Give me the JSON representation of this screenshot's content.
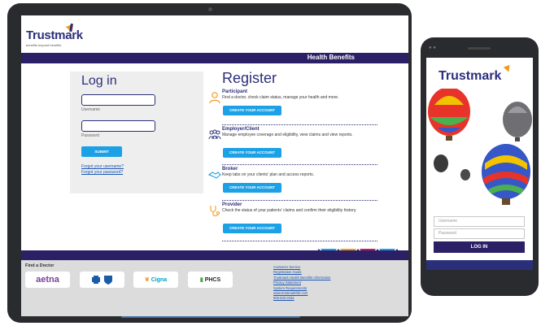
{
  "tablet": {
    "brand": {
      "name": "Trustmark",
      "tagline": "benefits beyond benefits"
    },
    "nav": {
      "title": "Health Benefits"
    },
    "login": {
      "title": "Log in",
      "username_label": "Username",
      "password_label": "Password",
      "submit": "SUBMIT",
      "forgot_username": "Forgot your username?",
      "forgot_password": "Forgot your password?"
    },
    "register": {
      "title": "Register",
      "items": [
        {
          "name": "Participant",
          "desc": "Find a doctor, check claim status, manage your health and more.",
          "button": "CREATE YOUR ACCOUNT",
          "icon": "person-icon"
        },
        {
          "name": "Employer/Client",
          "desc": "Manage employee coverage and eligibility, view claims and view reports.",
          "button": "CREATE YOUR ACCOUNT",
          "icon": "group-icon"
        },
        {
          "name": "Broker",
          "desc": "Keep tabs on your clients' plan and access reports.",
          "button": "CREATE YOUR ACCOUNT",
          "icon": "handshake-icon"
        },
        {
          "name": "Provider",
          "desc": "Check the status of your patients' claims and confirm their eligibility history.",
          "button": "CREATE YOUR ACCOUNT",
          "icon": "stethoscope-icon"
        }
      ]
    },
    "footer": {
      "find_doctor": "Find a Doctor",
      "partners": [
        "aetna",
        "Cigna",
        "PHCS"
      ],
      "links": [
        "Customer Service",
        "Registration Guide",
        "Trustmark Health Benefits Information",
        "Privacy Statement",
        "System Requirements",
        "www.trustmarkthb.com"
      ],
      "phone": "800.633.3332"
    }
  },
  "phone": {
    "brand": "Trustmark",
    "username_placeholder": "Username",
    "password_placeholder": "Password",
    "login_button": "LOG IN"
  },
  "colors": {
    "navy": "#2b1f66",
    "brand_blue": "#2b2f7a",
    "button_blue": "#1da1e6",
    "accent_orange": "#f39a1e"
  }
}
